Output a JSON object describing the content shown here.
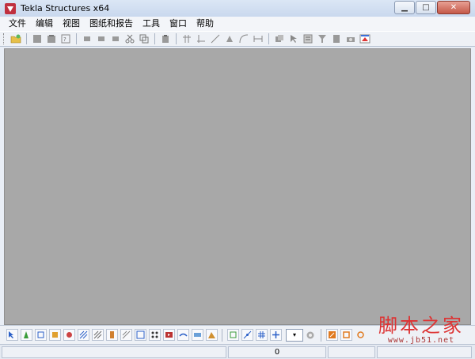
{
  "window": {
    "title": "Tekla Structures x64",
    "controls": {
      "minimize": "▁",
      "maximize": "□",
      "close": "✕"
    }
  },
  "menubar": {
    "items": [
      {
        "label": "文件"
      },
      {
        "label": "编辑"
      },
      {
        "label": "视图"
      },
      {
        "label": "图纸和报告"
      },
      {
        "label": "工具"
      },
      {
        "label": "窗口"
      },
      {
        "label": "帮助"
      }
    ]
  },
  "toolbar": {
    "groups": [
      [
        "open-model-icon"
      ],
      [
        "save-icon",
        "save-as-icon",
        "print-icon"
      ],
      [
        "tool-1-icon",
        "tool-2-icon",
        "tool-3-icon",
        "cut-icon",
        "copy-icon"
      ],
      [
        "paste-icon"
      ],
      [
        "grid-icon",
        "axis-icon",
        "measure-icon",
        "point-icon",
        "arc-icon",
        "dimension-icon"
      ],
      [
        "layer-icon",
        "select-icon",
        "properties-icon",
        "filter-icon",
        "document-icon",
        "camera-icon",
        "render-icon"
      ]
    ]
  },
  "bottom_toolbar": {
    "combo_arrow": "▾"
  },
  "watermark": {
    "main": "脚本之家",
    "sub": "www.jb51.net"
  },
  "statusbar": {
    "counter": "0"
  },
  "colors": {
    "workspace": "#a8a8a8",
    "titlebar": "#c9d8ee",
    "close_button": "#c45848",
    "watermark": "#d33333"
  }
}
